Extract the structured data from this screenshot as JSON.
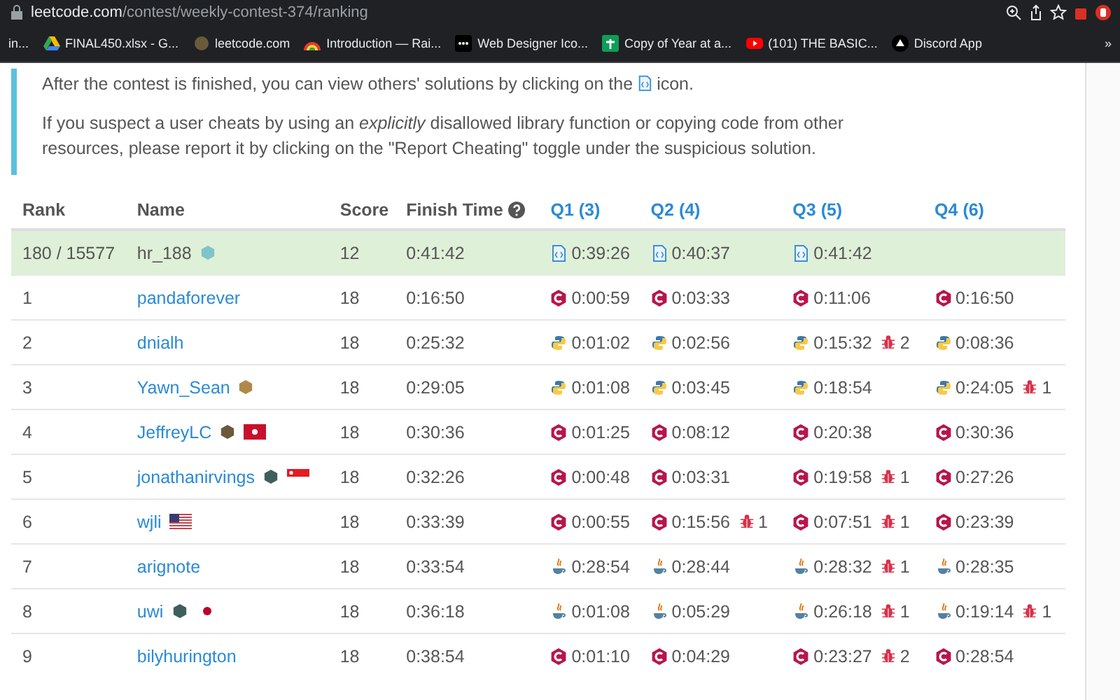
{
  "browser": {
    "url_host": "leetcode.com",
    "url_path": "/contest/weekly-contest-374/ranking",
    "bookmarks": [
      {
        "kind": "plain",
        "label": "in..."
      },
      {
        "kind": "drive",
        "label": "FINAL450.xlsx - G..."
      },
      {
        "kind": "coin",
        "label": "leetcode.com"
      },
      {
        "kind": "rainbow",
        "label": "Introduction — Rai..."
      },
      {
        "kind": "dots",
        "label": "Web Designer Ico..."
      },
      {
        "kind": "sheet",
        "label": "Copy of Year at a..."
      },
      {
        "kind": "youtube",
        "label": "(101) THE BASIC..."
      },
      {
        "kind": "discord",
        "label": "Discord App"
      }
    ],
    "more": "»"
  },
  "notice": {
    "line1_before": "After the contest is finished, you can view others' solutions by clicking on the",
    "line1_after": "icon.",
    "line2": "If you suspect a user cheats by using an *explicitly* disallowed library function or copying code from other resources, please report it by clicking on the \"Report Cheating\" toggle under the suspicious solution."
  },
  "table": {
    "columns": [
      "Rank",
      "Name",
      "Score",
      "Finish Time"
    ],
    "questions": [
      "Q1 (3)",
      "Q2 (4)",
      "Q3 (5)",
      "Q4 (6)"
    ],
    "rows": [
      {
        "rank": "180 / 15577",
        "name": "hr_188",
        "selected": true,
        "badges": [
          {
            "kind": "hex",
            "color": "#7fc4c8"
          }
        ],
        "score": "12",
        "finish": "0:41:42",
        "cells": [
          {
            "kind": "file",
            "time": "0:39:26"
          },
          {
            "kind": "file",
            "time": "0:40:37"
          },
          {
            "kind": "file",
            "time": "0:41:42"
          },
          null
        ]
      },
      {
        "rank": "1",
        "name": "pandaforever",
        "selected": false,
        "badges": [],
        "score": "18",
        "finish": "0:16:50",
        "cells": [
          {
            "kind": "cpp",
            "time": "0:00:59"
          },
          {
            "kind": "cpp",
            "time": "0:03:33"
          },
          {
            "kind": "cpp",
            "time": "0:11:06"
          },
          {
            "kind": "cpp",
            "time": "0:16:50"
          }
        ]
      },
      {
        "rank": "2",
        "name": "dnialh",
        "selected": false,
        "badges": [],
        "score": "18",
        "finish": "0:25:32",
        "cells": [
          {
            "kind": "python",
            "time": "0:01:02"
          },
          {
            "kind": "python",
            "time": "0:02:56"
          },
          {
            "kind": "python",
            "time": "0:15:32",
            "bugs": "2"
          },
          {
            "kind": "python",
            "time": "0:08:36"
          }
        ]
      },
      {
        "rank": "3",
        "name": "Yawn_Sean",
        "selected": false,
        "badges": [
          {
            "kind": "hex",
            "color": "#b0894a"
          }
        ],
        "score": "18",
        "finish": "0:29:05",
        "cells": [
          {
            "kind": "python",
            "time": "0:01:08"
          },
          {
            "kind": "python",
            "time": "0:03:45"
          },
          {
            "kind": "python",
            "time": "0:18:54"
          },
          {
            "kind": "python",
            "time": "0:24:05",
            "bugs": "1"
          }
        ]
      },
      {
        "rank": "4",
        "name": "JeffreyLC",
        "selected": false,
        "badges": [
          {
            "kind": "hex",
            "color": "#6b5a3a"
          },
          {
            "kind": "flag-hk"
          }
        ],
        "score": "18",
        "finish": "0:30:36",
        "cells": [
          {
            "kind": "cpp",
            "time": "0:01:25"
          },
          {
            "kind": "cpp",
            "time": "0:08:12"
          },
          {
            "kind": "cpp",
            "time": "0:20:38"
          },
          {
            "kind": "cpp",
            "time": "0:30:36"
          }
        ]
      },
      {
        "rank": "5",
        "name": "jonathanirvings",
        "selected": false,
        "badges": [
          {
            "kind": "hex",
            "color": "#3f5f5c"
          },
          {
            "kind": "flag-sg"
          }
        ],
        "score": "18",
        "finish": "0:32:26",
        "cells": [
          {
            "kind": "cpp",
            "time": "0:00:48"
          },
          {
            "kind": "cpp",
            "time": "0:03:31"
          },
          {
            "kind": "cpp",
            "time": "0:19:58",
            "bugs": "1"
          },
          {
            "kind": "cpp",
            "time": "0:27:26"
          }
        ]
      },
      {
        "rank": "6",
        "name": "wjli",
        "selected": false,
        "badges": [
          {
            "kind": "flag-us"
          }
        ],
        "score": "18",
        "finish": "0:33:39",
        "cells": [
          {
            "kind": "cpp",
            "time": "0:00:55"
          },
          {
            "kind": "cpp",
            "time": "0:15:56",
            "bugs": "1"
          },
          {
            "kind": "cpp",
            "time": "0:07:51",
            "bugs": "1"
          },
          {
            "kind": "cpp",
            "time": "0:23:39"
          }
        ]
      },
      {
        "rank": "7",
        "name": "arignote",
        "selected": false,
        "badges": [],
        "score": "18",
        "finish": "0:33:54",
        "cells": [
          {
            "kind": "java",
            "time": "0:28:54"
          },
          {
            "kind": "java",
            "time": "0:28:44"
          },
          {
            "kind": "java",
            "time": "0:28:32",
            "bugs": "1"
          },
          {
            "kind": "java",
            "time": "0:28:35"
          }
        ]
      },
      {
        "rank": "8",
        "name": "uwi",
        "selected": false,
        "badges": [
          {
            "kind": "hex",
            "color": "#3f5f5c"
          },
          {
            "kind": "flag-jp"
          }
        ],
        "score": "18",
        "finish": "0:36:18",
        "cells": [
          {
            "kind": "java",
            "time": "0:01:08"
          },
          {
            "kind": "java",
            "time": "0:05:29"
          },
          {
            "kind": "java",
            "time": "0:26:18",
            "bugs": "1"
          },
          {
            "kind": "java",
            "time": "0:19:14",
            "bugs": "1"
          }
        ]
      },
      {
        "rank": "9",
        "name": "bilyhurington",
        "selected": false,
        "badges": [],
        "score": "18",
        "finish": "0:38:54",
        "cells": [
          {
            "kind": "cpp",
            "time": "0:01:10"
          },
          {
            "kind": "cpp",
            "time": "0:04:29"
          },
          {
            "kind": "cpp",
            "time": "0:23:27",
            "bugs": "2"
          },
          {
            "kind": "cpp",
            "time": "0:28:54"
          }
        ]
      }
    ]
  }
}
